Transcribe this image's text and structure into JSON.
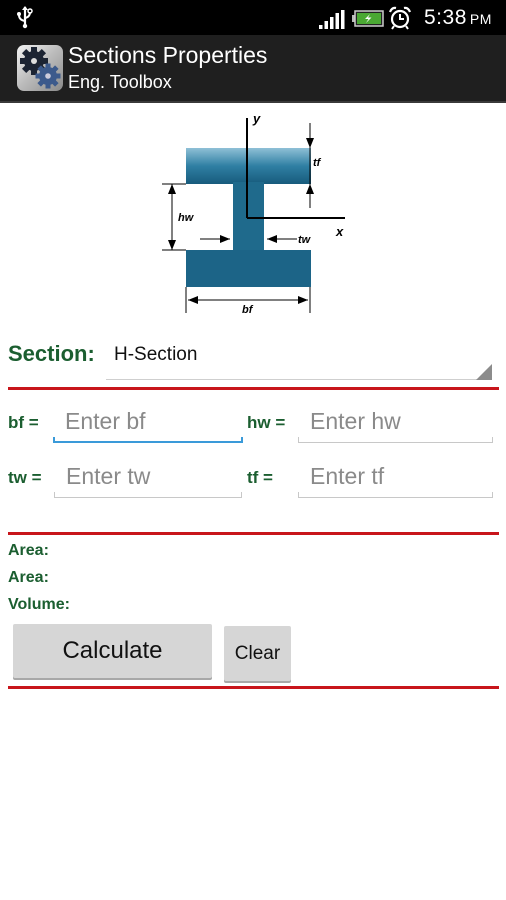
{
  "status_bar": {
    "time": "5:38",
    "ampm": "PM",
    "icons": [
      "usb-icon",
      "signal-icon",
      "battery-charging-icon",
      "alarm-icon"
    ]
  },
  "action_bar": {
    "title": "Sections Properties",
    "subtitle": "Eng. Toolbox",
    "icon": "gears-icon"
  },
  "diagram": {
    "labels": {
      "y": "y",
      "x": "x",
      "tf": "tf",
      "hw": "hw",
      "tw": "tw",
      "bf": "bf"
    },
    "color": "#1f6a8c"
  },
  "section": {
    "label": "Section:",
    "selected": "H-Section"
  },
  "inputs": {
    "bf": {
      "label": "bf =",
      "placeholder": "Enter bf",
      "value": ""
    },
    "hw": {
      "label": "hw =",
      "placeholder": "Enter hw",
      "value": ""
    },
    "tw": {
      "label": "tw =",
      "placeholder": "Enter tw",
      "value": ""
    },
    "tf": {
      "label": "tf =",
      "placeholder": "Enter tf",
      "value": ""
    }
  },
  "results": {
    "area1": "Area:",
    "area2": "Area:",
    "volume": "Volume:"
  },
  "buttons": {
    "calculate": "Calculate",
    "clear": "Clear"
  },
  "colors": {
    "label_green": "#1b5e30",
    "divider_red": "#c8151b",
    "focus_blue": "#3a9ad9"
  }
}
